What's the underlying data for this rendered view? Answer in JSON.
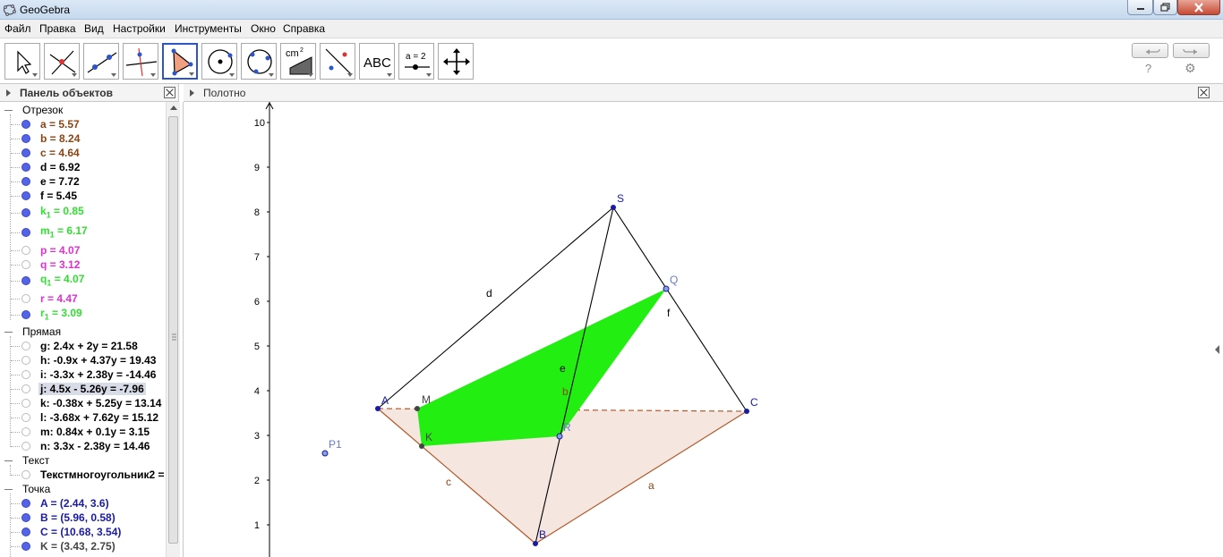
{
  "window": {
    "title": "GeoGebra"
  },
  "menu": [
    "Файл",
    "Правка",
    "Вид",
    "Настройки",
    "Инструменты",
    "Окно",
    "Справка"
  ],
  "toolbar": {
    "tools": [
      {
        "name": "move-tool",
        "icon": "cursor-arrow-icon"
      },
      {
        "name": "point-tool",
        "icon": "intersect-point-icon"
      },
      {
        "name": "line-tool",
        "icon": "line-through-points-icon"
      },
      {
        "name": "perpendicular-tool",
        "icon": "perpendicular-line-icon"
      },
      {
        "name": "polygon-tool",
        "icon": "polygon-icon",
        "selected": true
      },
      {
        "name": "circle-tool",
        "icon": "circle-center-point-icon"
      },
      {
        "name": "conic-tool",
        "icon": "circle-three-points-icon"
      },
      {
        "name": "measure-tool",
        "icon": "area-measure-icon",
        "text": "cm²"
      },
      {
        "name": "reflect-tool",
        "icon": "reflect-line-icon"
      },
      {
        "name": "text-tool",
        "icon": "text-icon",
        "text": "ABC"
      },
      {
        "name": "slider-tool",
        "icon": "slider-icon",
        "text": "a = 2"
      },
      {
        "name": "move-view-tool",
        "icon": "move-graphics-view-icon"
      }
    ],
    "help": "?",
    "settings_icon": "gear-icon"
  },
  "algebra_panel": {
    "title": "Панель объектов",
    "categories": [
      {
        "title": "Отрезок",
        "items": [
          {
            "text": "a = 5.57",
            "color": "#8b4513",
            "visible": true
          },
          {
            "text": "b = 8.24",
            "color": "#8b4513",
            "visible": true
          },
          {
            "text": "c = 4.64",
            "color": "#8b4513",
            "visible": true
          },
          {
            "text": "d = 6.92",
            "color": "#000000",
            "visible": true
          },
          {
            "text": "e = 7.72",
            "color": "#000000",
            "visible": true
          },
          {
            "text": "f = 5.45",
            "color": "#000000",
            "visible": true
          },
          {
            "text": "k",
            "sub": "1",
            "rest": " = 0.85",
            "color": "#33dd33",
            "visible": true
          },
          {
            "text": "m",
            "sub": "1",
            "rest": " = 6.17",
            "color": "#33dd33",
            "visible": true
          },
          {
            "text": "p = 4.07",
            "color": "#dd33cc",
            "visible": false
          },
          {
            "text": "q = 3.12",
            "color": "#dd33cc",
            "visible": false
          },
          {
            "text": "q",
            "sub": "1",
            "rest": " = 4.07",
            "color": "#33dd33",
            "visible": true
          },
          {
            "text": "r = 4.47",
            "color": "#dd33cc",
            "visible": false
          },
          {
            "text": "r",
            "sub": "1",
            "rest": " = 3.09",
            "color": "#33dd33",
            "visible": true
          }
        ]
      },
      {
        "title": "Прямая",
        "items": [
          {
            "text": "g: 2.4x + 2y = 21.58",
            "color": "#000000",
            "visible": false
          },
          {
            "text": "h: -0.9x + 4.37y = 19.43",
            "color": "#000000",
            "visible": false
          },
          {
            "text": "i: -3.3x + 2.38y = -14.46",
            "color": "#000000",
            "visible": false
          },
          {
            "text": "j: 4.5x - 5.26y = -7.96",
            "color": "#000000",
            "visible": false,
            "highlight": true
          },
          {
            "text": "k: -0.38x + 5.25y = 13.14",
            "color": "#000000",
            "visible": false
          },
          {
            "text": "l: -3.68x + 7.62y = 15.12",
            "color": "#000000",
            "visible": false
          },
          {
            "text": "m: 0.84x + 0.1y = 3.15",
            "color": "#000000",
            "visible": false
          },
          {
            "text": "n: 3.3x - 2.38y = 14.46",
            "color": "#000000",
            "visible": false
          }
        ]
      },
      {
        "title": "Текст",
        "items": [
          {
            "text": "Текстмногоугольник2 =",
            "color": "#000000",
            "visible": false
          }
        ]
      },
      {
        "title": "Точка",
        "items": [
          {
            "text": "A = (2.44, 3.6)",
            "color": "#1a1aa6",
            "visible": true
          },
          {
            "text": "B = (5.96, 0.58)",
            "color": "#1a1aa6",
            "visible": true
          },
          {
            "text": "C = (10.68, 3.54)",
            "color": "#1a1aa6",
            "visible": true
          },
          {
            "text": "K = (3.43, 2.75)",
            "color": "#444444",
            "visible": true
          }
        ]
      }
    ]
  },
  "graphics_panel": {
    "title": "Полотно",
    "y_ticks": [
      "1",
      "2",
      "3",
      "4",
      "5",
      "6",
      "7",
      "8",
      "9",
      "10"
    ],
    "points": [
      {
        "label": "S",
        "x": 8.1,
        "y": 8.1,
        "color": "#1a1aa6"
      },
      {
        "label": "Q",
        "x": 9.3,
        "y": 6.3,
        "color": "#1a1aa6"
      },
      {
        "label": "A",
        "x": 2.44,
        "y": 3.6,
        "color": "#1a1aa6"
      },
      {
        "label": "M",
        "x": 3.33,
        "y": 3.6,
        "color": "#444444"
      },
      {
        "label": "C",
        "x": 10.68,
        "y": 3.54,
        "color": "#1a1aa6"
      },
      {
        "label": "R",
        "x": 6.5,
        "y": 2.95,
        "color": "#1a1aa6"
      },
      {
        "label": "K",
        "x": 3.43,
        "y": 2.75,
        "color": "#444444"
      },
      {
        "label": "P1",
        "x": 0.3,
        "y": 2.6,
        "color": "#1a1aa6"
      },
      {
        "label": "B",
        "x": 5.96,
        "y": 0.58,
        "color": "#1a1aa6"
      }
    ],
    "segment_labels": [
      {
        "label": "d",
        "color": "#000000"
      },
      {
        "label": "f",
        "color": "#000000"
      },
      {
        "label": "e",
        "color": "#000000"
      },
      {
        "label": "b",
        "color": "#8b4513"
      },
      {
        "label": "c",
        "color": "#8b4513"
      },
      {
        "label": "a",
        "color": "#8b4513"
      }
    ],
    "colors": {
      "base_fill": "#f5e6e0",
      "base_stroke": "#b05a2a",
      "section_fill": "#22ee11",
      "edge": "#000000"
    }
  }
}
